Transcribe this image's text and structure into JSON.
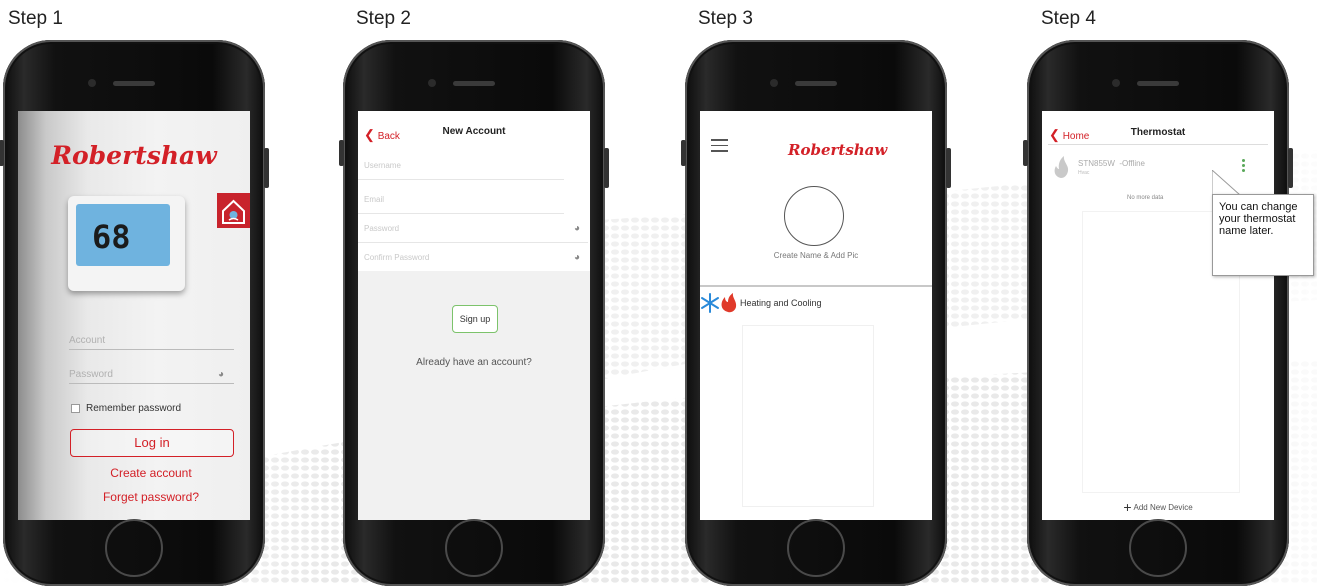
{
  "steps": [
    {
      "title": "Step 1"
    },
    {
      "title": "Step 2"
    },
    {
      "title": "Step 3"
    },
    {
      "title": "Step 4"
    }
  ],
  "step1": {
    "logo": "Robertshaw",
    "thermostat_display": "68",
    "account_placeholder": "Account",
    "password_placeholder": "Password",
    "remember_label": "Remember password",
    "login_label": "Log in",
    "create_account": "Create account",
    "forget_password": "Forget password?"
  },
  "step2": {
    "back_label": "Back",
    "title": "New Account",
    "fields": [
      {
        "placeholder": "Username"
      },
      {
        "placeholder": "Email"
      },
      {
        "placeholder": "Password"
      },
      {
        "placeholder": "Confirm Password"
      }
    ],
    "signup_label": "Sign up",
    "already_label": "Already have an account?"
  },
  "step3": {
    "logo": "Robertshaw",
    "create_pic_label": "Create Name & Add Pic",
    "heating_cooling_label": "Heating and Cooling"
  },
  "step4": {
    "home_label": "Home",
    "title": "Thermostat",
    "device_name": "STN855W",
    "device_status": "Offline",
    "device_sub": "Hvac",
    "no_more_data": "No more data",
    "add_device_label": "Add New Device",
    "callout_text": "You can change your thermostat name later."
  },
  "colors": {
    "brand_red": "#d32027",
    "signup_green": "#7cc36b",
    "menu_green": "#5aa85a"
  }
}
